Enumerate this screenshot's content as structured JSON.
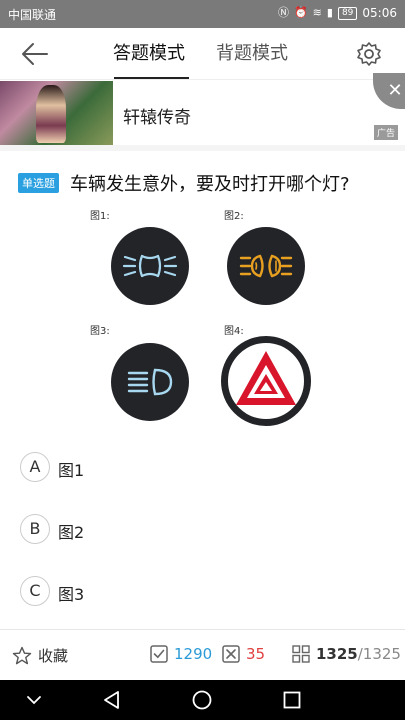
{
  "status_bar": {
    "carrier": "中国联通",
    "battery": "89",
    "time": "05:06"
  },
  "header": {
    "tabs": [
      "答题模式",
      "背题模式"
    ],
    "active_tab": "答题模式"
  },
  "ad": {
    "title": "轩辕传奇",
    "label": "广告",
    "close": "✕"
  },
  "question": {
    "type": "单选题",
    "text": "车辆发生意外，要及时打开哪个灯?",
    "figures": [
      {
        "label": "图1:",
        "icon": "side-light-icon"
      },
      {
        "label": "图2:",
        "icon": "fog-light-icon"
      },
      {
        "label": "图3:",
        "icon": "high-beam-icon"
      },
      {
        "label": "图4:",
        "icon": "hazard-warning-icon"
      }
    ],
    "options": [
      {
        "key": "A",
        "text": "图1"
      },
      {
        "key": "B",
        "text": "图2"
      },
      {
        "key": "C",
        "text": "图3"
      }
    ]
  },
  "bottom_bar": {
    "favorite": "收藏",
    "correct_count": "1290",
    "wrong_count": "35",
    "current": "1325",
    "total": "/1325"
  },
  "colors": {
    "accent": "#2aa0e0",
    "wrong": "#e04040",
    "hazard": "#d8152a",
    "fog": "#e8a020",
    "light_blue": "#a8d8f0"
  }
}
